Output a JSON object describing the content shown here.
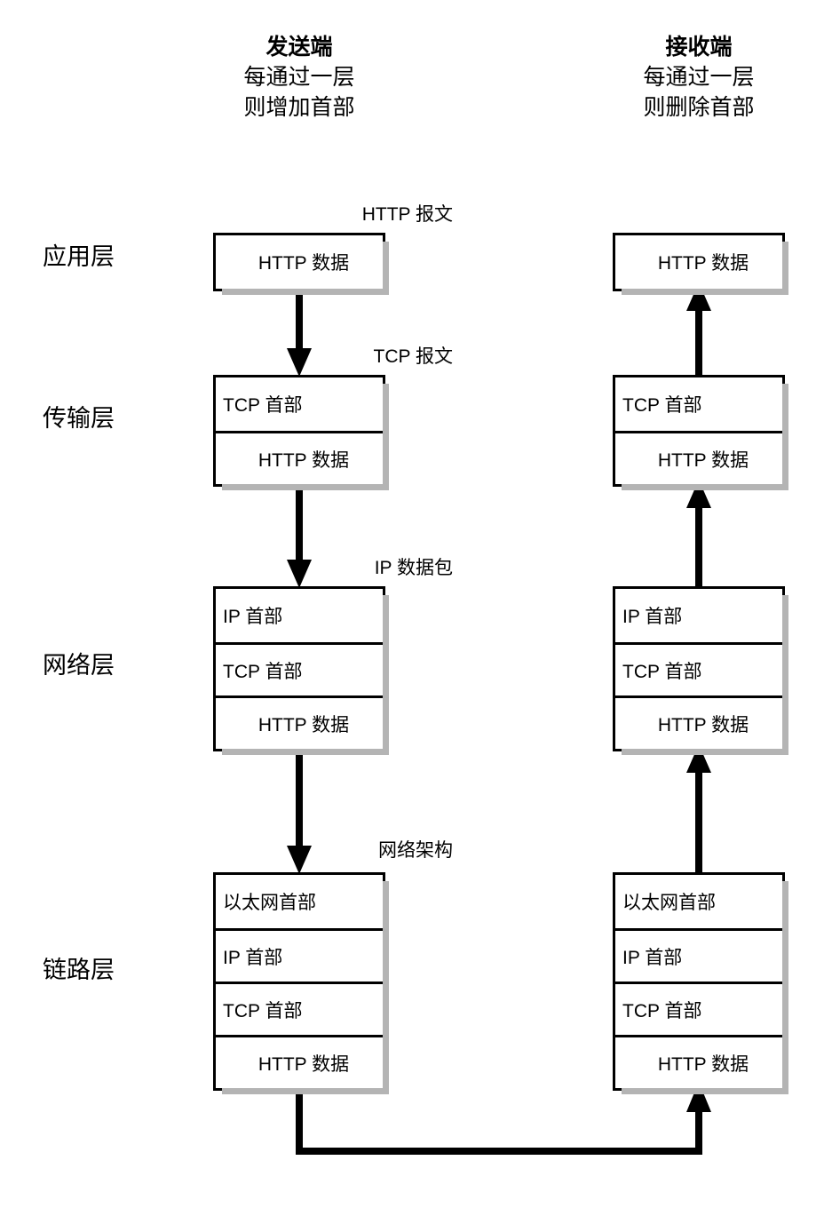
{
  "headers": {
    "sender": {
      "title": "发送端",
      "line1": "每通过一层",
      "line2": "则增加首部"
    },
    "receiver": {
      "title": "接收端",
      "line1": "每通过一层",
      "line2": "则删除首部"
    }
  },
  "layers": [
    {
      "name": "应用层",
      "caption": "HTTP 报文",
      "rows": [
        "HTTP 数据"
      ]
    },
    {
      "name": "传输层",
      "caption": "TCP 报文",
      "rows": [
        "TCP 首部",
        "HTTP 数据"
      ]
    },
    {
      "name": "网络层",
      "caption": "IP 数据包",
      "rows": [
        "IP 首部",
        "TCP 首部",
        "HTTP 数据"
      ]
    },
    {
      "name": "链路层",
      "caption": "网络架构",
      "rows": [
        "以太网首部",
        "IP 首部",
        "TCP 首部",
        "HTTP 数据"
      ]
    }
  ],
  "colors": {
    "line": "#000000",
    "shadow": "#b4b4b4",
    "background": "#ffffff"
  },
  "arrows": {
    "sender_direction": "down",
    "receiver_direction": "up",
    "bottom_direction": "right-then-up"
  }
}
